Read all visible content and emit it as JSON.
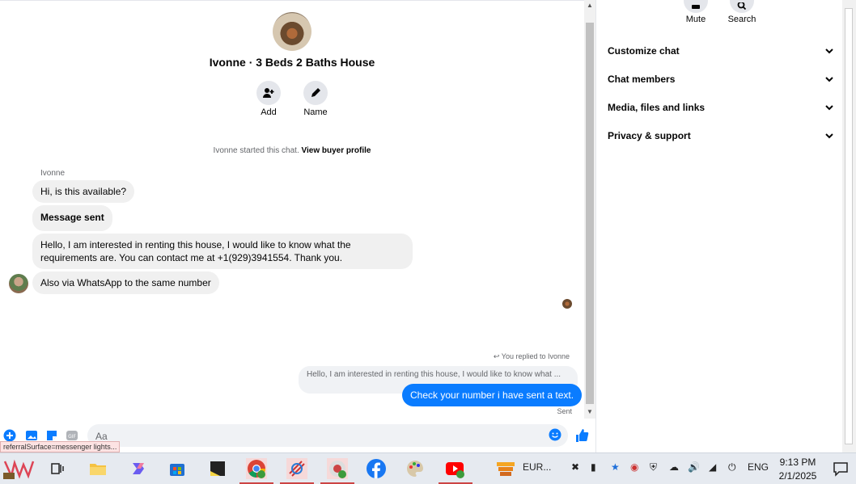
{
  "chat": {
    "title": "Ivonne · 3 Beds 2 Baths House",
    "actions": [
      {
        "label": "Add",
        "icon": "add-person-icon"
      },
      {
        "label": "Name",
        "icon": "pencil-icon"
      }
    ],
    "started_text": "Ivonne started this chat.",
    "view_profile_link": "View buyer profile",
    "sender_name": "Ivonne",
    "messages": [
      {
        "text": "Hi, is this available?"
      },
      {
        "text": "Message sent"
      },
      {
        "text": "Hello, I am interested in renting this house, I would like to know what the requirements are. You can contact me at +1(929)3941554. Thank you."
      },
      {
        "text": "Also via WhatsApp to the same number"
      }
    ],
    "replied_label": "You replied to Ivonne",
    "reply_quote": "Hello, I am interested in renting this house, I would like to know what ...",
    "outgoing_message": "Check your number i have sent a text.",
    "sent_status": "Sent"
  },
  "composer": {
    "placeholder": "Aa",
    "tooltip": "referralSurface=messenger lights..."
  },
  "panel": {
    "top_actions": [
      {
        "label": "Mute",
        "icon": "bell-icon"
      },
      {
        "label": "Search",
        "icon": "search-icon"
      }
    ],
    "sections": [
      {
        "label": "Customize chat"
      },
      {
        "label": "Chat members"
      },
      {
        "label": "Media, files and links"
      },
      {
        "label": "Privacy & support"
      }
    ]
  },
  "taskbar": {
    "pinned_label": "EUR...",
    "language": "ENG",
    "time": "9:13 PM",
    "date": "2/1/2025"
  },
  "colors": {
    "accent": "#0a7cff",
    "bubble_in": "#f0f0f0"
  }
}
